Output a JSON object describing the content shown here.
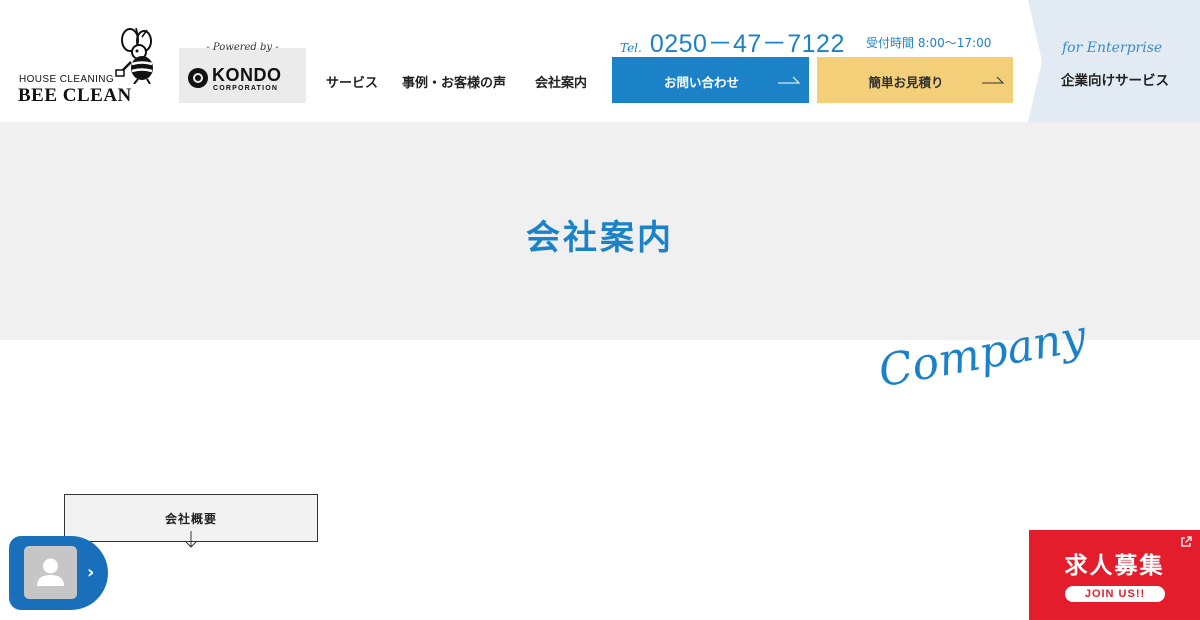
{
  "header": {
    "logo": {
      "tagline": "HOUSE CLEANING",
      "name": "BEE CLEAN"
    },
    "partner": {
      "powered_by": "- Powered by -",
      "name": "KONDO",
      "sub": "CORPORATION"
    },
    "nav": [
      {
        "label": "サービス"
      },
      {
        "label": "事例・お客様の声"
      },
      {
        "label": "会社案内"
      }
    ],
    "tel": {
      "label": "Tel.",
      "number": "0250－47－7122",
      "hours": "受付時間 8:00～17:00"
    },
    "buttons": {
      "contact": "お問い合わせ",
      "estimate": "簡単お見積り"
    },
    "enterprise": {
      "script": "for Enterprise",
      "label": "企業向けサービス"
    }
  },
  "hero": {
    "title": "会社案内",
    "script": "Company"
  },
  "anchor": {
    "label": "会社概要"
  },
  "recruit": {
    "title": "求人募集",
    "join": "JOIN US!!"
  },
  "colors": {
    "brand_blue": "#1c82c8",
    "estimate_yellow": "#f4cf79",
    "recruit_red": "#e41d2d",
    "hero_bg": "#f0f0f0"
  },
  "icons": {
    "arrow": "arrow-right-icon",
    "down": "arrow-down-icon",
    "user": "user-icon",
    "external": "external-link-icon",
    "chevron": "chevron-right-icon"
  }
}
